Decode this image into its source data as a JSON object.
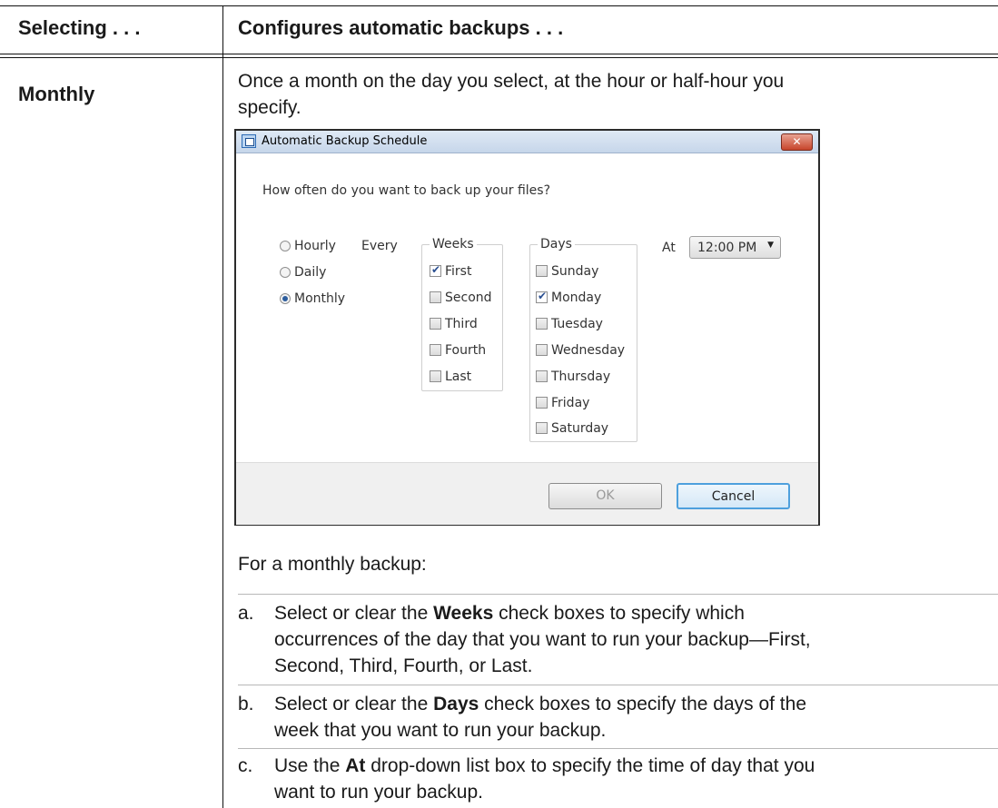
{
  "table": {
    "col1_header": "Selecting . . .",
    "col2_header": "Configures automatic backups . . .",
    "row_label": "Monthly",
    "desc_line1": "Once a month on the day you select, at the hour or half-hour you",
    "desc_line2": "specify.",
    "intro": "For a monthly backup:"
  },
  "steps": {
    "a": {
      "letter": "a.",
      "pre": "Select or clear the ",
      "bold": "Weeks",
      "line1_rest": " check boxes to specify which",
      "line2": "occurrences of the day that you want to run your backup—First,",
      "line3": "Second, Third, Fourth, or Last."
    },
    "b": {
      "letter": "b.",
      "pre": "Select or clear the ",
      "bold": "Days",
      "line1_rest": " check boxes to specify the days of the",
      "line2": "week that you want to run your backup."
    },
    "c": {
      "letter": "c.",
      "pre": "Use the ",
      "bold": "At",
      "line1_rest": " drop-down list box to specify the time of day that you",
      "line2": "want to run your backup."
    }
  },
  "dialog": {
    "title": "Automatic Backup Schedule",
    "close_symbol": "✕",
    "question": "How often do you want to back up your files?",
    "frequency": [
      "Hourly",
      "Daily",
      "Monthly"
    ],
    "selected_frequency": "Monthly",
    "every_label": "Every",
    "weeks_legend": "Weeks",
    "weeks": [
      "First",
      "Second",
      "Third",
      "Fourth",
      "Last"
    ],
    "weeks_checked": [
      "First"
    ],
    "days_legend": "Days",
    "days": [
      "Sunday",
      "Monday",
      "Tuesday",
      "Wednesday",
      "Thursday",
      "Friday",
      "Saturday"
    ],
    "days_checked": [
      "Monday"
    ],
    "at_label": "At",
    "time_value": "12:00 PM",
    "ok_label": "OK",
    "cancel_label": "Cancel"
  },
  "colors": {
    "primary_button_border": "#4ea0dd",
    "checkmark": "#2a4f91",
    "close_button": "#c7452b"
  }
}
